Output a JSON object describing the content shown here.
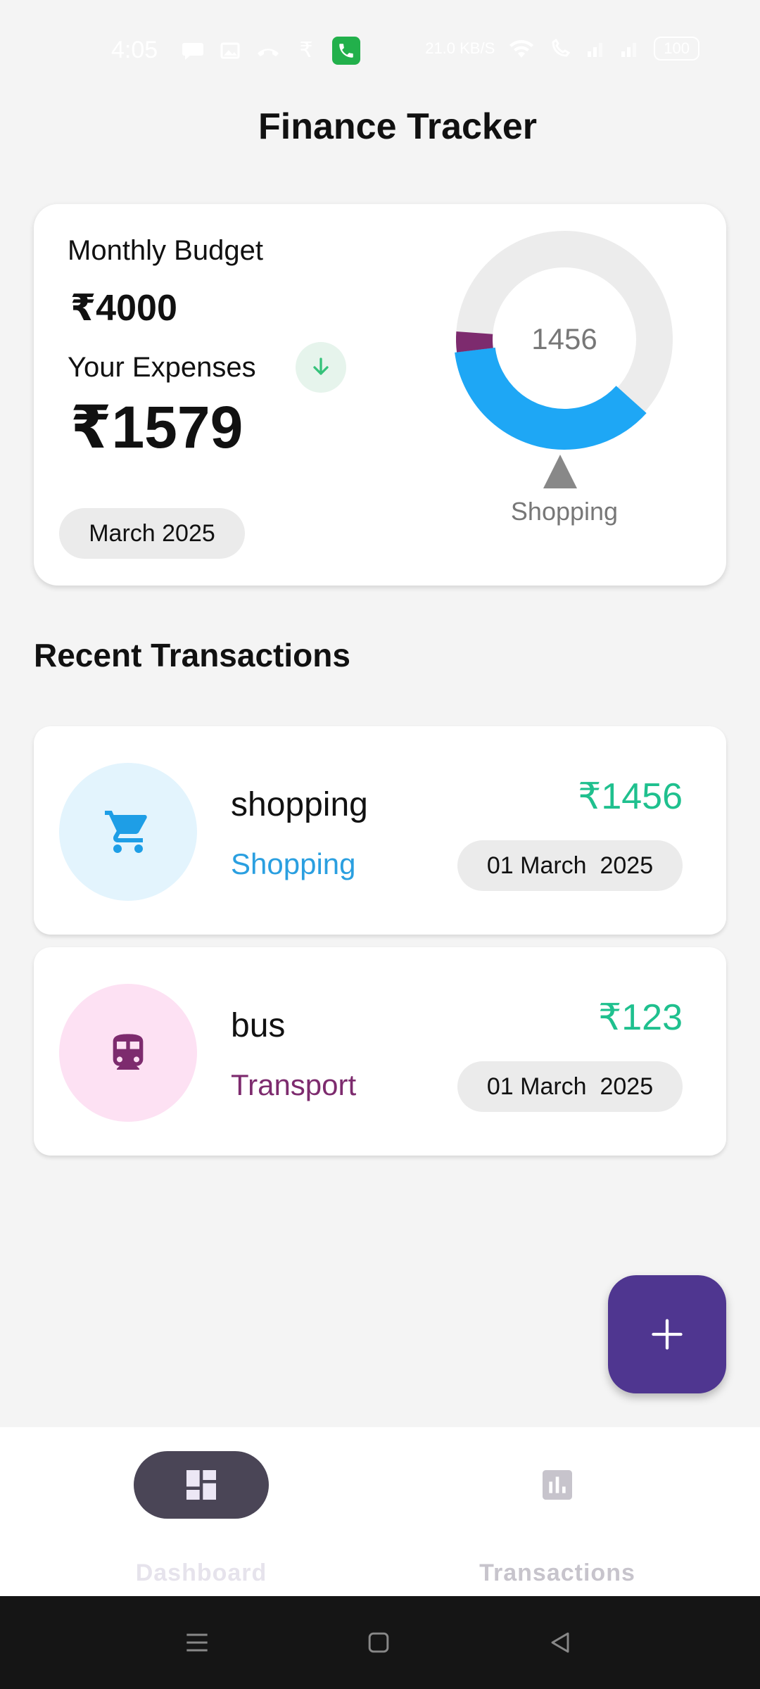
{
  "status_bar": {
    "time": "4:05",
    "speed": "21.0 KB/S",
    "battery": "100",
    "icons": [
      "message-icon",
      "gallery-icon",
      "call-missed-icon",
      "rupee-icon",
      "phone-call-icon",
      "wifi-icon",
      "volte-icon",
      "signal-icon",
      "signal-icon-2"
    ]
  },
  "header": {
    "title": "Finance Tracker"
  },
  "summary": {
    "budget_label": "Monthly Budget",
    "budget_value": "₹4000",
    "expenses_label": "Your Expenses",
    "expenses_value": "₹1579",
    "trend_icon": "arrow-down-icon",
    "month": "March 2025",
    "chart_center": "1456",
    "chart_label": "Shopping"
  },
  "chart_data": {
    "type": "pie",
    "categories": [
      "Shopping",
      "Transport"
    ],
    "values": [
      1456,
      123
    ],
    "total": 4000,
    "colors": {
      "Shopping": "#1ea7f5",
      "Transport": "#7d2b6e",
      "remaining": "#ececec"
    }
  },
  "recent": {
    "title": "Recent Transactions",
    "transactions": [
      {
        "title": "shopping",
        "category": "Shopping",
        "amount": "₹1456",
        "date": "01 March  2025",
        "icon": "shopping-cart-icon",
        "icon_color": "#1e9ee6",
        "circle_color": "#e3f4fd",
        "category_color": "#2a9fe0"
      },
      {
        "title": "bus",
        "category": "Transport",
        "amount": "₹123",
        "date": "01 March  2025",
        "icon": "train-icon",
        "icon_color": "#7d2b6e",
        "circle_color": "#fde1f3",
        "category_color": "#7d2b6e"
      }
    ]
  },
  "fab": {
    "icon": "plus-icon"
  },
  "bottom_nav": {
    "items": [
      {
        "label": "Dashboard",
        "icon": "dashboard-icon",
        "active": true
      },
      {
        "label": "Transactions",
        "icon": "bar-chart-icon",
        "active": false
      }
    ]
  },
  "system_nav": {
    "icons": [
      "menu-icon",
      "home-icon",
      "back-icon"
    ]
  }
}
